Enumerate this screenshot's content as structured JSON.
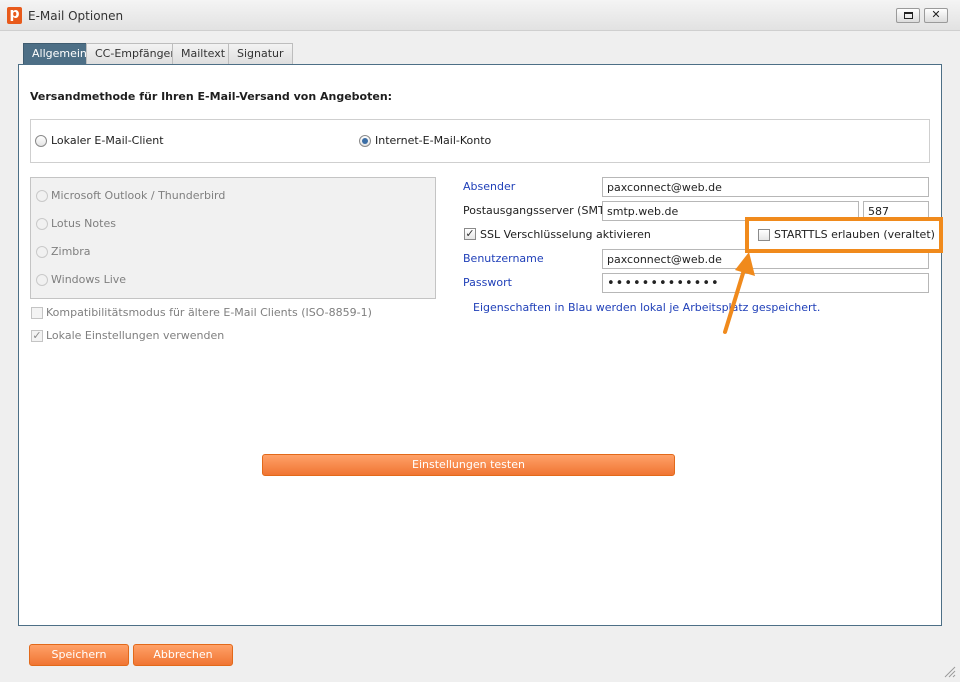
{
  "window": {
    "logo": "p",
    "title": "E-Mail Optionen",
    "close_glyph": "✕"
  },
  "tabs": [
    {
      "label": "Allgemein",
      "active": true
    },
    {
      "label": "CC-Empfänger",
      "active": false
    },
    {
      "label": "Mailtext",
      "active": false
    },
    {
      "label": "Signatur",
      "active": false
    }
  ],
  "heading": "Versandmethode für Ihren E-Mail-Versand von Angeboten:",
  "method": {
    "local_label": "Lokaler E-Mail-Client",
    "local_selected": false,
    "internet_label": "Internet-E-Mail-Konto",
    "internet_selected": true
  },
  "clients": [
    {
      "label": "Microsoft Outlook / Thunderbird"
    },
    {
      "label": "Lotus Notes"
    },
    {
      "label": "Zimbra"
    },
    {
      "label": "Windows Live"
    }
  ],
  "options": {
    "compat_label": "Kompatibilitätsmodus für ältere E-Mail Clients (ISO-8859-1)",
    "compat_checked": false,
    "local_settings_label": "Lokale Einstellungen verwenden",
    "local_settings_checked": true
  },
  "account": {
    "sender_label": "Absender",
    "sender_value": "paxconnect@web.de",
    "smtp_label": "Postausgangsserver (SMTP)",
    "smtp_value": "smtp.web.de",
    "port_value": "587",
    "ssl_label": "SSL Verschlüsselung aktivieren",
    "ssl_checked": true,
    "starttls_label": "STARTTLS erlauben (veraltet)",
    "starttls_checked": false,
    "username_label": "Benutzername",
    "username_value": "paxconnect@web.de",
    "password_label": "Passwort",
    "password_value": "•••••••••••••",
    "hint": "Eigenschaften in Blau werden lokal je Arbeitsplatz gespeichert."
  },
  "buttons": {
    "test": "Einstellungen testen",
    "save": "Speichern",
    "cancel": "Abbrechen"
  },
  "colors": {
    "accent": "#f07533",
    "highlight": "#f08a1c",
    "tab_active": "#4d6f86",
    "blue_label": "#1f3fb8"
  }
}
